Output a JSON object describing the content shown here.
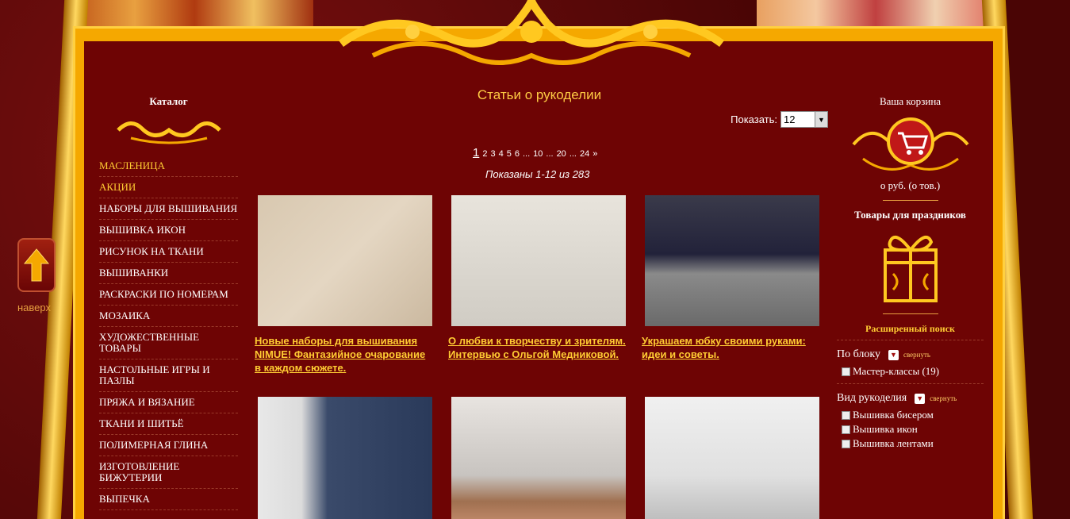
{
  "nav": {
    "up_label": "наверх"
  },
  "catalog": {
    "title": "Каталог",
    "items": [
      {
        "label": "Масленица",
        "hl": true
      },
      {
        "label": "Акции",
        "hl": true
      },
      {
        "label": "Наборы для вышивания"
      },
      {
        "label": "Вышивка икон"
      },
      {
        "label": "Рисунок на ткани"
      },
      {
        "label": "Вышиванки"
      },
      {
        "label": "Раскраски по номерам"
      },
      {
        "label": "Мозаика"
      },
      {
        "label": "Художественные товары"
      },
      {
        "label": "Настольные игры и пазлы"
      },
      {
        "label": "Пряжа и вязание"
      },
      {
        "label": "Ткани и шитьё"
      },
      {
        "label": "Полимерная глина"
      },
      {
        "label": "Изготовление бижутерии"
      },
      {
        "label": "Выпечка"
      }
    ]
  },
  "main": {
    "title": "Статьи о рукоделии",
    "show_label": "Показать:",
    "show_value": "12",
    "pager": {
      "current": "1",
      "pages": [
        "2",
        "3",
        "4",
        "5",
        "6",
        "...",
        "10",
        "...",
        "20",
        "...",
        "24",
        "»"
      ]
    },
    "shown_text": "Показаны 1-12 из 283",
    "cards": [
      {
        "title": "Новые наборы для вышивания NIMUE! Фантазийное очарование в каждом сюжете."
      },
      {
        "title": "О любви к творчеству и зрителям. Интервью с Ольгой Медниковой."
      },
      {
        "title": "Украшаем юбку своими руками: идеи и советы."
      },
      {
        "title": ""
      },
      {
        "title": ""
      },
      {
        "title": ""
      }
    ]
  },
  "cart": {
    "title": "Ваша корзина",
    "summary": "о руб.   (о тов.)"
  },
  "holiday": {
    "title": "Товары для праздников"
  },
  "search": {
    "title": "Расширенный поиск",
    "collapse_label": "свернуть",
    "groups": [
      {
        "title": "По блоку",
        "options": [
          "Мастер-классы (19)"
        ]
      },
      {
        "title": "Вид рукоделия",
        "options": [
          "Вышивка бисером",
          "Вышивка икон",
          "Вышивка лентами"
        ]
      }
    ]
  },
  "colors": {
    "accent": "#ffcc33",
    "background": "#6e0404",
    "frame": "#f5a800"
  }
}
